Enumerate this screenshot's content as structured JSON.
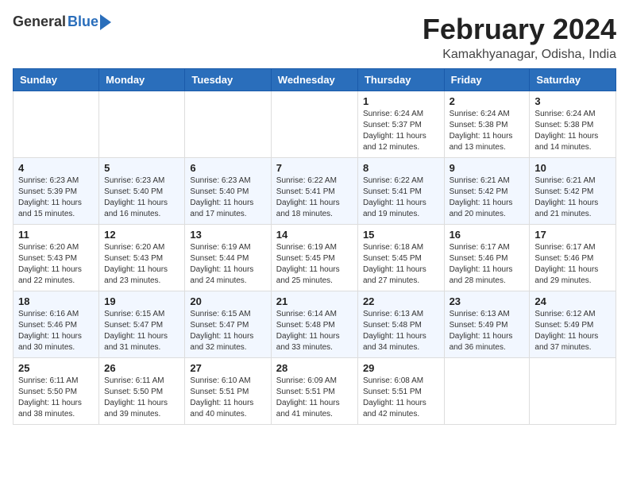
{
  "logo": {
    "general": "General",
    "blue": "Blue"
  },
  "title": "February 2024",
  "subtitle": "Kamakhyanagar, Odisha, India",
  "headers": [
    "Sunday",
    "Monday",
    "Tuesday",
    "Wednesday",
    "Thursday",
    "Friday",
    "Saturday"
  ],
  "weeks": [
    [
      {
        "day": "",
        "info": ""
      },
      {
        "day": "",
        "info": ""
      },
      {
        "day": "",
        "info": ""
      },
      {
        "day": "",
        "info": ""
      },
      {
        "day": "1",
        "info": "Sunrise: 6:24 AM\nSunset: 5:37 PM\nDaylight: 11 hours and 12 minutes."
      },
      {
        "day": "2",
        "info": "Sunrise: 6:24 AM\nSunset: 5:38 PM\nDaylight: 11 hours and 13 minutes."
      },
      {
        "day": "3",
        "info": "Sunrise: 6:24 AM\nSunset: 5:38 PM\nDaylight: 11 hours and 14 minutes."
      }
    ],
    [
      {
        "day": "4",
        "info": "Sunrise: 6:23 AM\nSunset: 5:39 PM\nDaylight: 11 hours and 15 minutes."
      },
      {
        "day": "5",
        "info": "Sunrise: 6:23 AM\nSunset: 5:40 PM\nDaylight: 11 hours and 16 minutes."
      },
      {
        "day": "6",
        "info": "Sunrise: 6:23 AM\nSunset: 5:40 PM\nDaylight: 11 hours and 17 minutes."
      },
      {
        "day": "7",
        "info": "Sunrise: 6:22 AM\nSunset: 5:41 PM\nDaylight: 11 hours and 18 minutes."
      },
      {
        "day": "8",
        "info": "Sunrise: 6:22 AM\nSunset: 5:41 PM\nDaylight: 11 hours and 19 minutes."
      },
      {
        "day": "9",
        "info": "Sunrise: 6:21 AM\nSunset: 5:42 PM\nDaylight: 11 hours and 20 minutes."
      },
      {
        "day": "10",
        "info": "Sunrise: 6:21 AM\nSunset: 5:42 PM\nDaylight: 11 hours and 21 minutes."
      }
    ],
    [
      {
        "day": "11",
        "info": "Sunrise: 6:20 AM\nSunset: 5:43 PM\nDaylight: 11 hours and 22 minutes."
      },
      {
        "day": "12",
        "info": "Sunrise: 6:20 AM\nSunset: 5:43 PM\nDaylight: 11 hours and 23 minutes."
      },
      {
        "day": "13",
        "info": "Sunrise: 6:19 AM\nSunset: 5:44 PM\nDaylight: 11 hours and 24 minutes."
      },
      {
        "day": "14",
        "info": "Sunrise: 6:19 AM\nSunset: 5:45 PM\nDaylight: 11 hours and 25 minutes."
      },
      {
        "day": "15",
        "info": "Sunrise: 6:18 AM\nSunset: 5:45 PM\nDaylight: 11 hours and 27 minutes."
      },
      {
        "day": "16",
        "info": "Sunrise: 6:17 AM\nSunset: 5:46 PM\nDaylight: 11 hours and 28 minutes."
      },
      {
        "day": "17",
        "info": "Sunrise: 6:17 AM\nSunset: 5:46 PM\nDaylight: 11 hours and 29 minutes."
      }
    ],
    [
      {
        "day": "18",
        "info": "Sunrise: 6:16 AM\nSunset: 5:46 PM\nDaylight: 11 hours and 30 minutes."
      },
      {
        "day": "19",
        "info": "Sunrise: 6:15 AM\nSunset: 5:47 PM\nDaylight: 11 hours and 31 minutes."
      },
      {
        "day": "20",
        "info": "Sunrise: 6:15 AM\nSunset: 5:47 PM\nDaylight: 11 hours and 32 minutes."
      },
      {
        "day": "21",
        "info": "Sunrise: 6:14 AM\nSunset: 5:48 PM\nDaylight: 11 hours and 33 minutes."
      },
      {
        "day": "22",
        "info": "Sunrise: 6:13 AM\nSunset: 5:48 PM\nDaylight: 11 hours and 34 minutes."
      },
      {
        "day": "23",
        "info": "Sunrise: 6:13 AM\nSunset: 5:49 PM\nDaylight: 11 hours and 36 minutes."
      },
      {
        "day": "24",
        "info": "Sunrise: 6:12 AM\nSunset: 5:49 PM\nDaylight: 11 hours and 37 minutes."
      }
    ],
    [
      {
        "day": "25",
        "info": "Sunrise: 6:11 AM\nSunset: 5:50 PM\nDaylight: 11 hours and 38 minutes."
      },
      {
        "day": "26",
        "info": "Sunrise: 6:11 AM\nSunset: 5:50 PM\nDaylight: 11 hours and 39 minutes."
      },
      {
        "day": "27",
        "info": "Sunrise: 6:10 AM\nSunset: 5:51 PM\nDaylight: 11 hours and 40 minutes."
      },
      {
        "day": "28",
        "info": "Sunrise: 6:09 AM\nSunset: 5:51 PM\nDaylight: 11 hours and 41 minutes."
      },
      {
        "day": "29",
        "info": "Sunrise: 6:08 AM\nSunset: 5:51 PM\nDaylight: 11 hours and 42 minutes."
      },
      {
        "day": "",
        "info": ""
      },
      {
        "day": "",
        "info": ""
      }
    ]
  ]
}
